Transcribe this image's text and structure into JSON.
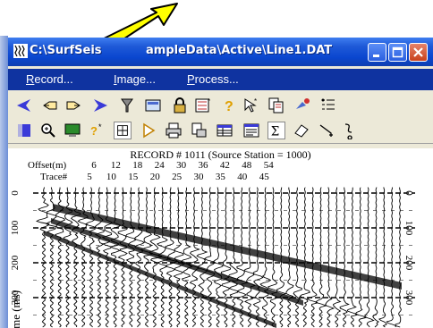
{
  "window": {
    "title": "C:\\SurfSeis\\SampleData\\Active\\Line1.DAT",
    "title_visible_left": "C:\\SurfSeis",
    "title_visible_right": "ampleData\\Active\\Line1.DAT"
  },
  "menu": {
    "items": [
      {
        "label": "Record...",
        "underline": "R"
      },
      {
        "label": "Image...",
        "underline": "I"
      },
      {
        "label": "Process...",
        "underline": "P"
      }
    ]
  },
  "toolbar1": [
    "arrow-left-icon",
    "hand-pointer-left-icon",
    "hand-pointer-right-icon",
    "arrow-right-icon",
    "filter-icon",
    "display-icon",
    "lock-icon",
    "gain-icon",
    "help-icon",
    "select-icon",
    "copy-icon",
    "pick-icon",
    "properties-icon"
  ],
  "toolbar2": [
    "color-icon",
    "zoom-icon",
    "monitor-icon",
    "help-cursor-icon",
    "layout-icon",
    "play-icon",
    "print-icon",
    "print-setup-icon",
    "table-icon",
    "report-icon",
    "sum-icon",
    "eraser-icon",
    "line-icon",
    "curve-icon"
  ],
  "record": {
    "title": "RECORD # 1011 (Source Station = 1000)",
    "offset_label": "Offset(m)",
    "trace_label": "Trace#",
    "offsets": [
      "6",
      "12",
      "18",
      "24",
      "30",
      "36",
      "42",
      "48",
      "54"
    ],
    "traces": [
      "5",
      "10",
      "15",
      "20",
      "25",
      "30",
      "35",
      "40",
      "45"
    ],
    "time_label": "Time (ms)",
    "time_ticks": [
      "0",
      "100",
      "200",
      "300"
    ]
  },
  "colors": {
    "title_bar": "#0a46cf",
    "menu_bar": "#0f33a0",
    "arrow_fill": "#ffff00",
    "background": "#ece9d8"
  }
}
